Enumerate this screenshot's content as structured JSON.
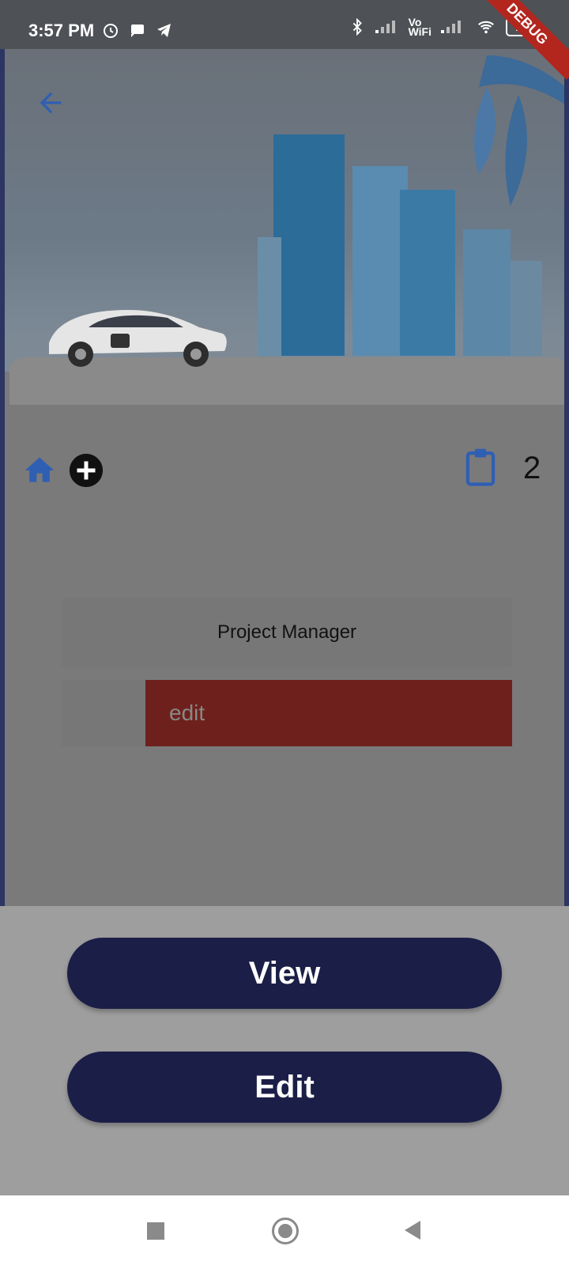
{
  "status_bar": {
    "time": "3:57 PM",
    "vo_wifi_label_top": "Vo",
    "vo_wifi_label_bottom": "WiFi",
    "battery": "16"
  },
  "debug_ribbon": "DEBUG",
  "counters": {
    "task_count": "2"
  },
  "card": {
    "title": "Project Manager",
    "swipe_action_label": "edit"
  },
  "bottom_sheet": {
    "view_label": "View",
    "edit_label": "Edit"
  },
  "icons": {
    "back": "arrow-left-icon",
    "home": "home-icon",
    "add": "add-circle-icon",
    "clipboard": "clipboard-icon"
  },
  "colors": {
    "accent_blue": "#2f5fb3",
    "button_navy": "#1b1f47",
    "edit_red": "#6e211c"
  }
}
